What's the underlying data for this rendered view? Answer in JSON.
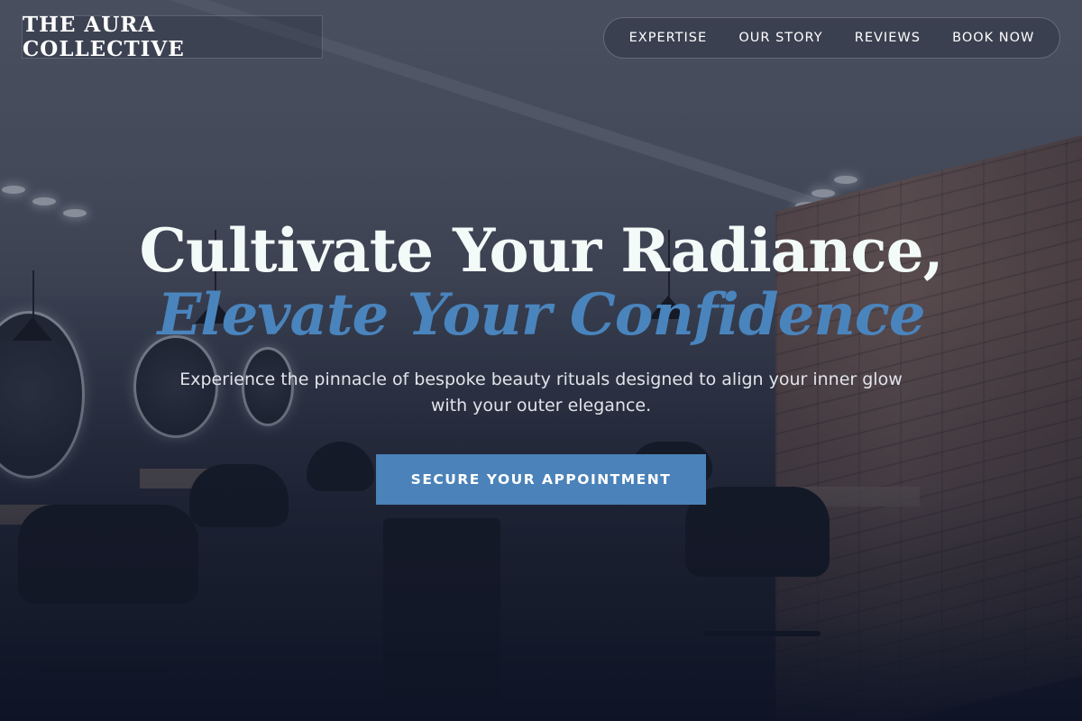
{
  "brand": {
    "logo_text": "THE AURA COLLECTIVE"
  },
  "nav": {
    "items": [
      {
        "label": "EXPERTISE"
      },
      {
        "label": "OUR STORY"
      },
      {
        "label": "REVIEWS"
      },
      {
        "label": "BOOK NOW"
      }
    ]
  },
  "hero": {
    "title_line1": "Cultivate Your Radiance,",
    "title_line2": "Elevate Your Confidence",
    "subtitle": "Experience the pinnacle of bespoke beauty rituals designed to align your inner glow with your outer elegance.",
    "cta_label": "SECURE YOUR APPOINTMENT",
    "background_image": "salon-interior"
  },
  "colors": {
    "accent": "#4a84bd",
    "button": "#4a82b9",
    "title": "#f3fbf9",
    "overlay": "#1c2234"
  }
}
